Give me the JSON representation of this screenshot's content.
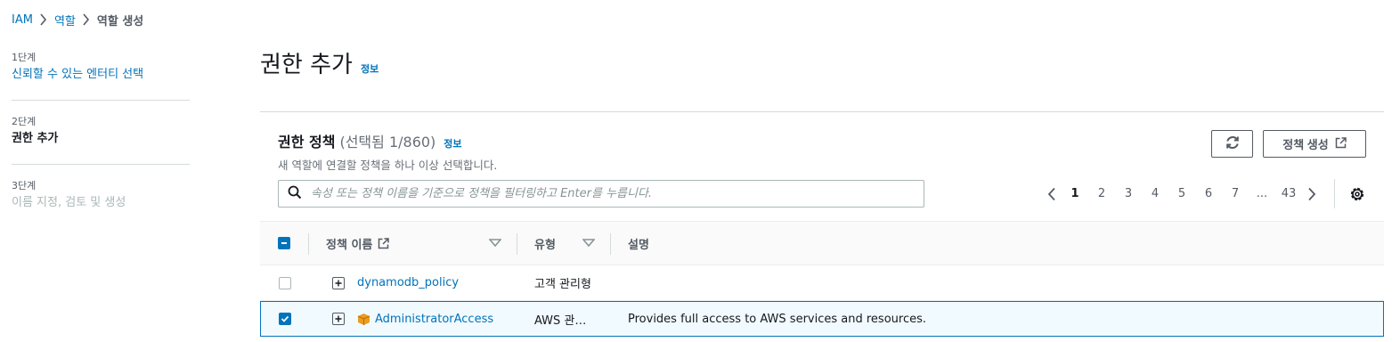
{
  "breadcrumb": {
    "items": [
      "IAM",
      "역할",
      "역할 생성"
    ]
  },
  "steps": [
    {
      "num": "1단계",
      "title": "신뢰할 수 있는 엔터티 선택",
      "state": "link"
    },
    {
      "num": "2단계",
      "title": "권한 추가",
      "state": "active"
    },
    {
      "num": "3단계",
      "title": "이름 지정, 검토 및 생성",
      "state": "disabled"
    }
  ],
  "page": {
    "title": "권한 추가",
    "info": "정보"
  },
  "policies": {
    "title": "권한 정책",
    "count": "(선택됨 1/860)",
    "info": "정보",
    "description": "새 역할에 연결할 정책을 하나 이상 선택합니다.",
    "create_label": "정책 생성",
    "search_placeholder": "속성 또는 정책 이름을 기준으로 정책을 필터링하고 Enter를 누릅니다.",
    "pages": [
      "1",
      "2",
      "3",
      "4",
      "5",
      "6",
      "7",
      "...",
      "43"
    ],
    "current_page": "1"
  },
  "table": {
    "columns": [
      "정책 이름",
      "유형",
      "설명"
    ],
    "rows": [
      {
        "name": "dynamodb_policy",
        "type": "고객 관리형",
        "description": "",
        "checked": false,
        "aws_managed": false
      },
      {
        "name": "AdministratorAccess",
        "type": "AWS 관…",
        "description": "Provides full access to AWS services and resources.",
        "checked": true,
        "aws_managed": true
      }
    ]
  },
  "colors": {
    "link": "#0073bb",
    "selected_row_bg": "#f1faff",
    "aws_icon": "#ec9c20"
  }
}
